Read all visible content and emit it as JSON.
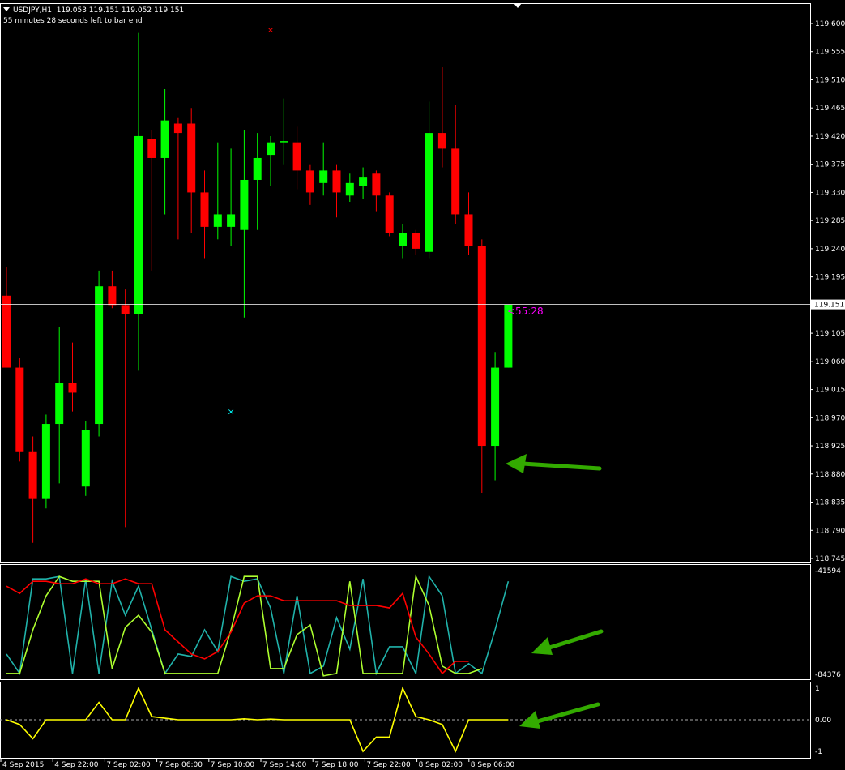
{
  "header": {
    "symbol": "USDJPY,H1",
    "ohlc": "119.053 119.151 119.052 119.151",
    "bar_timer": "55 minutes 28 seconds left to bar end"
  },
  "countdown_label": "<55:28",
  "current_price_label": "119.151",
  "colors": {
    "bull": "#00ff00",
    "bear": "#ff0000",
    "background": "#000000",
    "grid_border": "#ffffff",
    "cyan_line": "#20b2aa",
    "lime_line": "#adff2f",
    "red_line": "#ff0000",
    "yellow_line": "#ffff00",
    "arrow": "#33aa00",
    "countdown": "#ff00ff"
  },
  "chart_data": [
    {
      "type": "candlestick",
      "ylim": [
        118.745,
        119.6
      ],
      "y_ticks": [
        "119.600",
        "119.555",
        "119.510",
        "119.465",
        "119.420",
        "119.375",
        "119.330",
        "119.285",
        "119.240",
        "119.195",
        "119.151",
        "119.105",
        "119.060",
        "119.015",
        "118.970",
        "118.925",
        "118.880",
        "118.835",
        "118.790",
        "118.745"
      ],
      "candles": [
        {
          "o": 119.165,
          "h": 119.21,
          "l": 119.055,
          "c": 119.05
        },
        {
          "o": 119.05,
          "h": 119.065,
          "l": 118.9,
          "c": 118.915
        },
        {
          "o": 118.915,
          "h": 118.94,
          "l": 118.77,
          "c": 118.84
        },
        {
          "o": 118.84,
          "h": 118.975,
          "l": 118.825,
          "c": 118.96
        },
        {
          "o": 118.96,
          "h": 119.115,
          "l": 118.865,
          "c": 119.025
        },
        {
          "o": 119.025,
          "h": 119.09,
          "l": 118.98,
          "c": 119.01
        },
        {
          "o": 118.86,
          "h": 118.965,
          "l": 118.845,
          "c": 118.95
        },
        {
          "o": 118.96,
          "h": 119.205,
          "l": 118.94,
          "c": 119.18
        },
        {
          "o": 119.18,
          "h": 119.205,
          "l": 119.145,
          "c": 119.15
        },
        {
          "o": 119.15,
          "h": 119.175,
          "l": 118.795,
          "c": 119.135
        },
        {
          "o": 119.135,
          "h": 119.585,
          "l": 119.045,
          "c": 119.42
        },
        {
          "o": 119.415,
          "h": 119.43,
          "l": 119.205,
          "c": 119.385
        },
        {
          "o": 119.385,
          "h": 119.495,
          "l": 119.295,
          "c": 119.445
        },
        {
          "o": 119.44,
          "h": 119.45,
          "l": 119.255,
          "c": 119.425
        },
        {
          "o": 119.44,
          "h": 119.465,
          "l": 119.265,
          "c": 119.33
        },
        {
          "o": 119.33,
          "h": 119.365,
          "l": 119.225,
          "c": 119.275
        },
        {
          "o": 119.275,
          "h": 119.41,
          "l": 119.255,
          "c": 119.295
        },
        {
          "o": 119.275,
          "h": 119.4,
          "l": 119.245,
          "c": 119.295
        },
        {
          "o": 119.27,
          "h": 119.43,
          "l": 119.13,
          "c": 119.35
        },
        {
          "o": 119.35,
          "h": 119.425,
          "l": 119.27,
          "c": 119.385
        },
        {
          "o": 119.39,
          "h": 119.42,
          "l": 119.34,
          "c": 119.41
        },
        {
          "o": 119.41,
          "h": 119.48,
          "l": 119.375,
          "c": 119.412
        },
        {
          "o": 119.41,
          "h": 119.435,
          "l": 119.335,
          "c": 119.365
        },
        {
          "o": 119.365,
          "h": 119.375,
          "l": 119.31,
          "c": 119.33
        },
        {
          "o": 119.345,
          "h": 119.41,
          "l": 119.325,
          "c": 119.365
        },
        {
          "o": 119.365,
          "h": 119.375,
          "l": 119.29,
          "c": 119.33
        },
        {
          "o": 119.325,
          "h": 119.36,
          "l": 119.315,
          "c": 119.345
        },
        {
          "o": 119.34,
          "h": 119.37,
          "l": 119.32,
          "c": 119.355
        },
        {
          "o": 119.36,
          "h": 119.365,
          "l": 119.3,
          "c": 119.325
        },
        {
          "o": 119.325,
          "h": 119.33,
          "l": 119.26,
          "c": 119.265
        },
        {
          "o": 119.245,
          "h": 119.28,
          "l": 119.225,
          "c": 119.265
        },
        {
          "o": 119.265,
          "h": 119.27,
          "l": 119.23,
          "c": 119.24
        },
        {
          "o": 119.235,
          "h": 119.475,
          "l": 119.225,
          "c": 119.425
        },
        {
          "o": 119.425,
          "h": 119.53,
          "l": 119.37,
          "c": 119.4
        },
        {
          "o": 119.4,
          "h": 119.47,
          "l": 119.28,
          "c": 119.295
        },
        {
          "o": 119.295,
          "h": 119.33,
          "l": 119.23,
          "c": 119.245
        },
        {
          "o": 119.245,
          "h": 119.255,
          "l": 118.85,
          "c": 118.925
        },
        {
          "o": 118.925,
          "h": 119.075,
          "l": 118.87,
          "c": 119.05
        },
        {
          "o": 119.05,
          "h": 119.151,
          "l": 119.05,
          "c": 119.151
        }
      ],
      "markers": [
        {
          "index": 20,
          "price": 119.59,
          "color": "#ff0000",
          "glyph": "×"
        },
        {
          "index": 17,
          "price": 118.98,
          "color": "#00ffff",
          "glyph": "×"
        }
      ],
      "current_price": 119.151
    },
    {
      "type": "line",
      "ylim": [
        -84376,
        -41594
      ],
      "y_ticks": [
        "-41594",
        "-84376"
      ],
      "series": [
        {
          "color": "#20b2aa",
          "values": [
            -76000,
            -84000,
            -45000,
            -45000,
            -44000,
            -84000,
            -45000,
            -84000,
            -46000,
            -60000,
            -48000,
            -66000,
            -84000,
            -76000,
            -77000,
            -66000,
            -75000,
            -44000,
            -46000,
            -45000,
            -57000,
            -84000,
            -52000,
            -84000,
            -81000,
            -61000,
            -74000,
            -45000,
            -84000,
            -73000,
            -73000,
            -84000,
            -44000,
            -52000,
            -84000,
            -80000,
            -84000,
            -66000,
            -46000
          ]
        },
        {
          "color": "#adff2f",
          "values": [
            -84000,
            -84000,
            -66000,
            -52000,
            -44000,
            -46000,
            -46000,
            -46000,
            -82000,
            -65000,
            -60000,
            -67000,
            -84000,
            -84000,
            -84000,
            -84000,
            -84000,
            -66000,
            -44000,
            -44000,
            -82000,
            -82000,
            -68000,
            -64000,
            -85000,
            -84000,
            -46000,
            -84000,
            -84000,
            -84000,
            -84000,
            -44000,
            -56000,
            -81000,
            -84000,
            -84000,
            -82000
          ]
        },
        {
          "color": "#ff0000",
          "values": [
            -48000,
            -51000,
            -46000,
            -46000,
            -47000,
            -47000,
            -45000,
            -47000,
            -47000,
            -45000,
            -47000,
            -47000,
            -66000,
            -71000,
            -76000,
            -78000,
            -75000,
            -67000,
            -55000,
            -52000,
            -52000,
            -54000,
            -54000,
            -54000,
            -54000,
            -54000,
            -56000,
            -56000,
            -56000,
            -57000,
            -51000,
            -69000,
            -76000,
            -84000,
            -79000,
            -79000
          ]
        }
      ]
    },
    {
      "type": "line",
      "ylim": [
        -1,
        1
      ],
      "y_ticks": [
        "1",
        "0.00",
        "-1"
      ],
      "series": [
        {
          "color": "#ffff00",
          "values": [
            0,
            -0.15,
            -0.6,
            0,
            0,
            0,
            0,
            0.55,
            0,
            0,
            1,
            0.1,
            0.05,
            0,
            0,
            0,
            0,
            0,
            0.03,
            0,
            0.02,
            0,
            0,
            0,
            0,
            0,
            0,
            -1.0,
            -0.55,
            -0.55,
            1.0,
            0.1,
            0,
            -0.15,
            -1.0,
            0,
            0,
            0,
            0
          ]
        }
      ]
    }
  ],
  "x_axis_labels": [
    "4 Sep 2015",
    "4 Sep 22:00",
    "7 Sep 02:00",
    "7 Sep 06:00",
    "7 Sep 10:00",
    "7 Sep 14:00",
    "7 Sep 18:00",
    "7 Sep 22:00",
    "8 Sep 02:00",
    "8 Sep 06:00"
  ]
}
